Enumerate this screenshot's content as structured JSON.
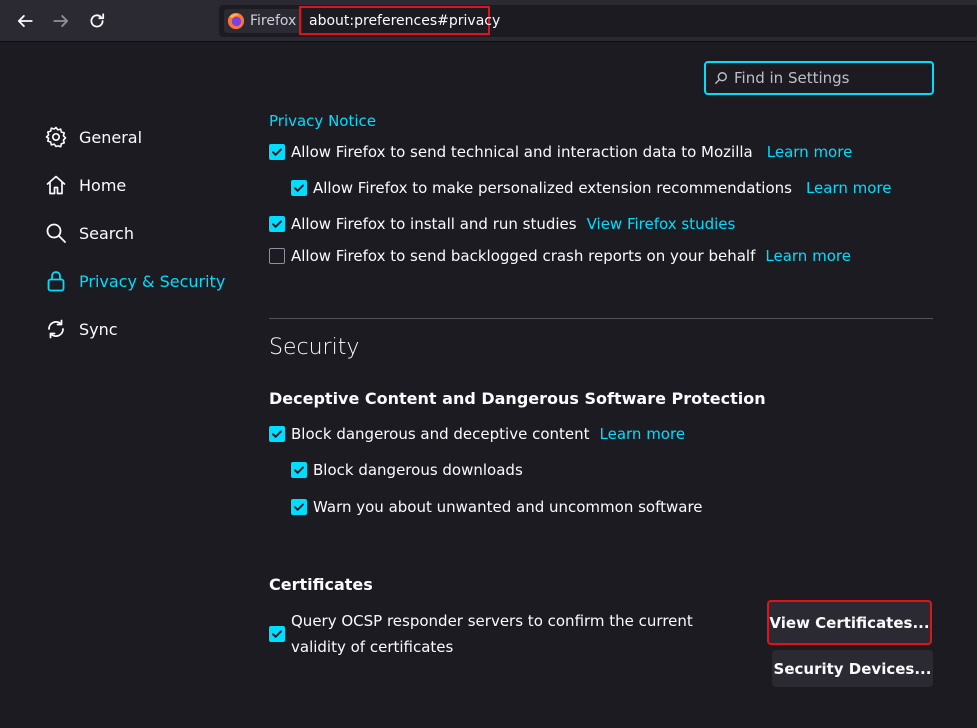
{
  "toolbar": {
    "identity_label": "Firefox",
    "url": "about:preferences#privacy"
  },
  "search": {
    "placeholder": "Find in Settings"
  },
  "sidebar": {
    "items": [
      {
        "label": "General",
        "icon": "gear-icon"
      },
      {
        "label": "Home",
        "icon": "home-icon"
      },
      {
        "label": "Search",
        "icon": "search-icon"
      },
      {
        "label": "Privacy & Security",
        "icon": "lock-icon"
      },
      {
        "label": "Sync",
        "icon": "sync-icon"
      }
    ]
  },
  "data_collection": {
    "privacy_notice_link": "Privacy Notice",
    "items": [
      {
        "label": "Allow Firefox to send technical and interaction data to Mozilla",
        "checked": true,
        "link": "Learn more"
      },
      {
        "label": "Allow Firefox to make personalized extension recommendations",
        "checked": true,
        "link": "Learn more"
      },
      {
        "label": "Allow Firefox to install and run studies",
        "checked": true,
        "link": "View Firefox studies"
      },
      {
        "label": "Allow Firefox to send backlogged crash reports on your behalf",
        "checked": false,
        "link": "Learn more"
      }
    ]
  },
  "security": {
    "title": "Security",
    "deceptive": {
      "heading": "Deceptive Content and Dangerous Software Protection",
      "block_label": "Block dangerous and deceptive content",
      "block_link": "Learn more",
      "downloads_label": "Block dangerous downloads",
      "warn_label": "Warn you about unwanted and uncommon software"
    },
    "certificates": {
      "heading": "Certificates",
      "ocsp_label": "Query OCSP responder servers to confirm the current validity of certificates",
      "view_button": "View Certificates...",
      "devices_button": "Security Devices..."
    }
  },
  "colors": {
    "accent": "#00ddff",
    "highlight_box": "#e0121b",
    "background": "#1c1b22"
  }
}
